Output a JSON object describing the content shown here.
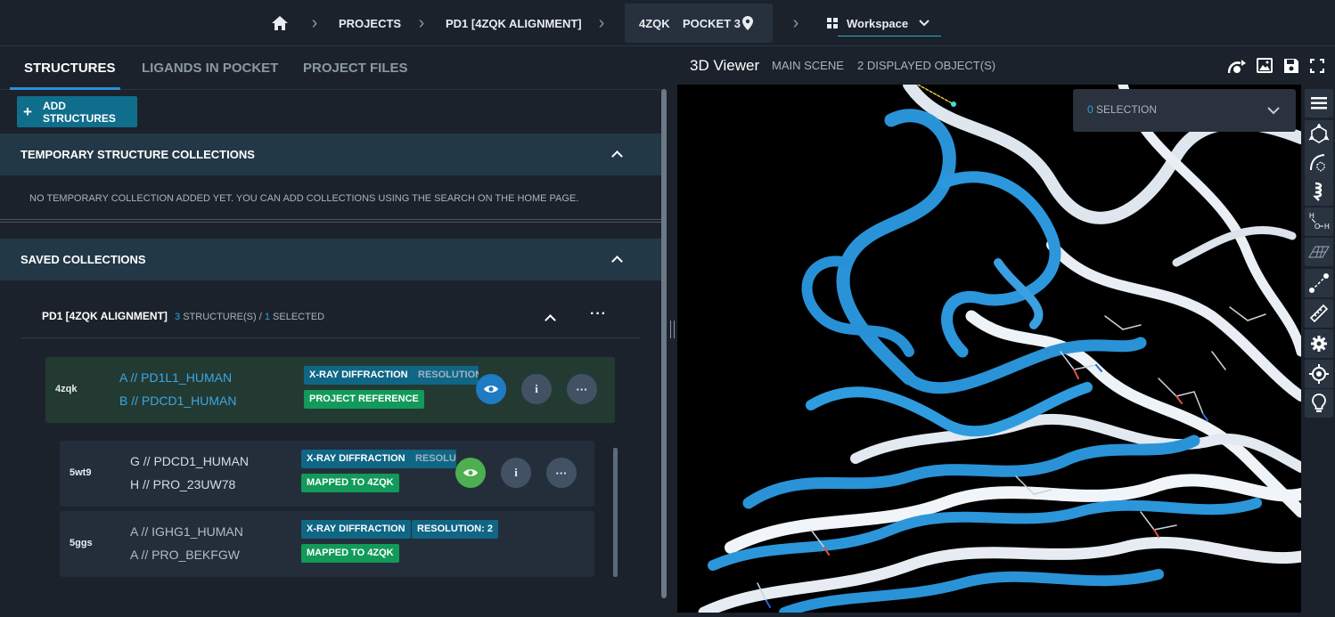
{
  "breadcrumb": {
    "projects": "PROJECTS",
    "project": "PD1 [4ZQK ALIGNMENT]",
    "structure": "4ZQK",
    "pocket": "POCKET 3",
    "workspace": "Workspace"
  },
  "tabs": [
    {
      "label": "STRUCTURES"
    },
    {
      "label": "LIGANDS IN POCKET"
    },
    {
      "label": "PROJECT FILES"
    }
  ],
  "add_structures": "ADD STRUCTURES",
  "temporary": {
    "title": "TEMPORARY STRUCTURE COLLECTIONS",
    "empty_text": "NO TEMPORARY COLLECTION ADDED YET. YOU CAN ADD COLLECTIONS USING THE SEARCH ON THE HOME PAGE."
  },
  "saved": {
    "title": "SAVED COLLECTIONS",
    "collection": {
      "name": "PD1 [4ZQK ALIGNMENT]",
      "structures_count": "3",
      "structures_text": "STRUCTURE(S) /",
      "selected_count": "1",
      "selected_text": "SELECTED"
    }
  },
  "structures": [
    {
      "code": "4zqk",
      "chain1": "A // PD1L1_HUMAN",
      "chain2": "B // PDCD1_HUMAN",
      "badge1": "X-RAY DIFFRACTION",
      "badge2": "RESOLUTION",
      "badge3": "PROJECT REFERENCE"
    },
    {
      "code": "5wt9",
      "chain1": "G // PDCD1_HUMAN",
      "chain2": "H // PRO_23UW78",
      "badge1": "X-RAY DIFFRACTION",
      "badge2": "RESOLU",
      "badge3": "MAPPED TO 4ZQK"
    },
    {
      "code": "5ggs",
      "chain1": "A // IGHG1_HUMAN",
      "chain2": "A // PRO_BEKFGW",
      "badge1": "X-RAY DIFFRACTION",
      "badge2": "RESOLUTION: 2",
      "badge3": "MAPPED TO 4ZQK"
    }
  ],
  "viewer": {
    "title": "3D Viewer",
    "scene": "MAIN SCENE",
    "objects": "2 DISPLAYED OBJECT(S)",
    "selection_count": "0",
    "selection_text": "SELECTION"
  },
  "toolbar_icons": [
    "menu-icon",
    "molecule-icon",
    "surface-icon",
    "cartoon-icon",
    "hydrogen-icon",
    "mesh-icon",
    "distance-icon",
    "ruler-icon",
    "gear-icon",
    "target-icon",
    "lightbulb-icon"
  ],
  "colors": {
    "accent": "#2b8fd6",
    "badge_blue": "#0f6685",
    "badge_green": "#129a5a",
    "eye_active": "#1e7bc4",
    "eye_green": "#4cb050",
    "protein_blue": "#2a93d8"
  }
}
